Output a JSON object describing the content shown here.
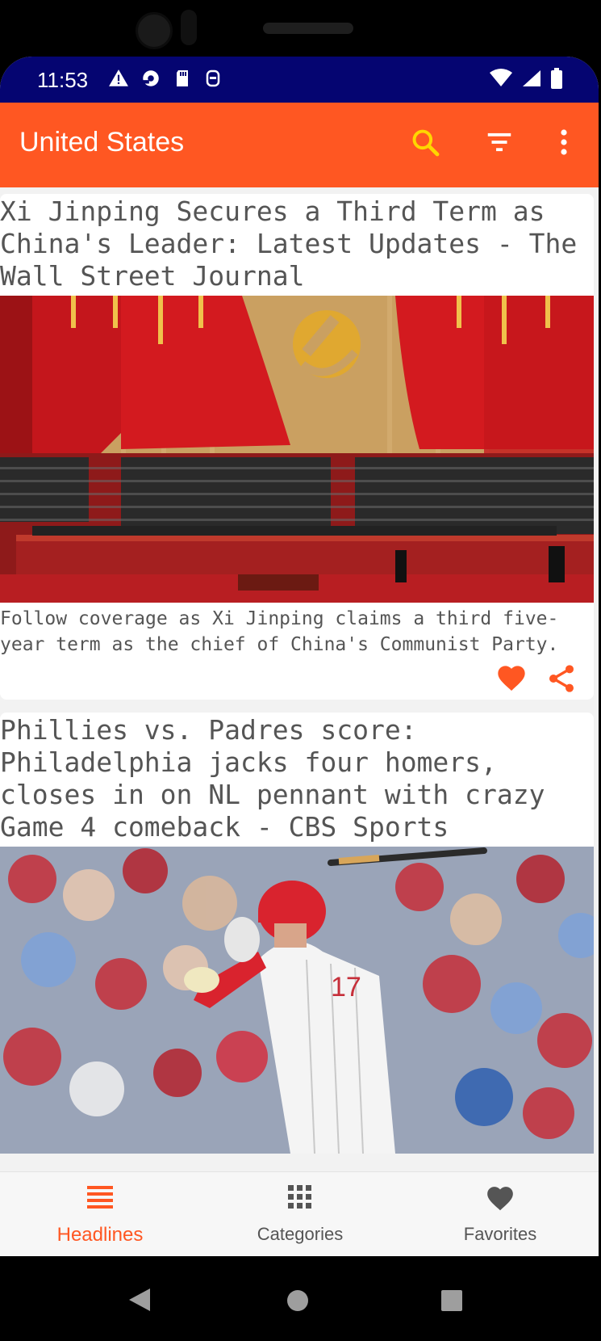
{
  "status_bar": {
    "time": "11:53",
    "left_icons": [
      "warning-icon",
      "sync-icon",
      "sd-card-icon",
      "app-icon"
    ],
    "right_icons": [
      "wifi-icon",
      "signal-icon",
      "battery-icon"
    ],
    "background": "#050571"
  },
  "app_bar": {
    "title": "United States",
    "background": "#ff5722",
    "search_icon_color": "#ffd600",
    "actions": [
      "search-icon",
      "filter-icon",
      "more-vert-icon"
    ]
  },
  "articles": [
    {
      "title": "Xi Jinping Secures a Third Term as China's Leader: Latest Updates - The Wall Street Journal",
      "description": "Follow coverage as Xi Jinping claims a third five-year term as the chief of China's Communist Party.",
      "favorited": true
    },
    {
      "title": "Phillies vs. Padres score: Philadelphia jacks four homers, closes in on NL pennant with crazy Game 4 comeback - CBS Sports",
      "description": ""
    }
  ],
  "bottom_nav": {
    "items": [
      {
        "label": "Headlines",
        "icon": "list-icon",
        "active": true
      },
      {
        "label": "Categories",
        "icon": "grid-icon",
        "active": false
      },
      {
        "label": "Favorites",
        "icon": "heart-icon",
        "active": false
      }
    ],
    "active_color": "#ff5722",
    "inactive_color": "#555555"
  },
  "system_nav": [
    "back-icon",
    "home-icon",
    "recents-icon"
  ]
}
